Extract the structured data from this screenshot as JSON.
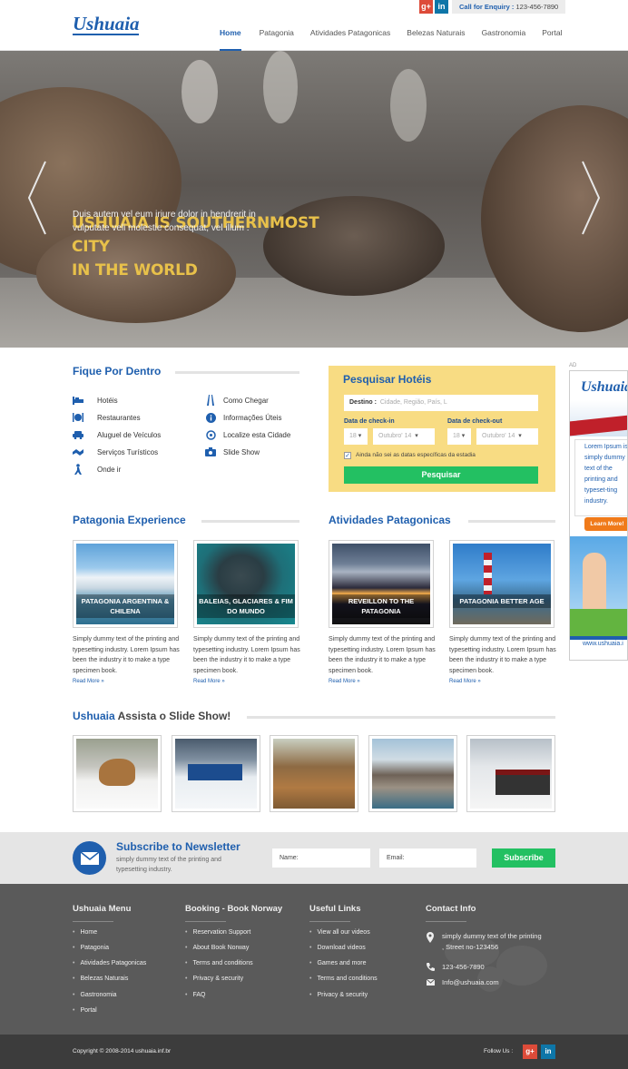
{
  "header": {
    "logo": "Ushuaia",
    "call_label": "Call for Enquiry :",
    "call_number": "123-456-7890",
    "social": [
      "g+",
      "in"
    ],
    "nav": [
      "Home",
      "Patagonia",
      "Atividades Patagonicas",
      "Belezas Naturais",
      "Gastronomia",
      "Portal"
    ]
  },
  "hero": {
    "title_line1": "USHUAIA IS  SOUTHERNMOST CITY",
    "title_line2": "IN THE WORLD",
    "subtitle": "Duis autem vel eum iriure dolor in hendrerit in vulputate veli molestie consequat, vel illum ."
  },
  "fique": {
    "title": "Fique Por Dentro",
    "items_left": [
      "Hotéis",
      "Restaurantes",
      "Aluguel de Veículos",
      "Serviços Turísticos",
      "Onde ir"
    ],
    "items_right": [
      "Como Chegar",
      "Informações Úteis",
      "Localize esta Cidade",
      "Slide Show"
    ]
  },
  "search": {
    "title": "Pesquisar Hotéis",
    "destino_label": "Destino :",
    "destino_placeholder": "Cidade, Região, País, L",
    "checkin_label": "Data de check-in",
    "checkout_label": "Data de check-out",
    "day_in": "18",
    "month_in": "Outubro' 14",
    "day_out": "18",
    "month_out": "Outubro' 14",
    "checkbox_label": "Ainda não sei as datas específicas da estadia",
    "button": "Pesquisar"
  },
  "ad": {
    "tag": "AD",
    "brand": "Ushuaia",
    "text": "Lorem Ipsum is simply dummy text of the printing and typeset-ting industry.",
    "button": "Learn More!",
    "url": "www.ushuaia.i"
  },
  "patagonia": {
    "title": "Patagonia Experience",
    "cards": [
      {
        "caption": "PATAGONIA ARGENTINA & CHILENA"
      },
      {
        "caption": "BALEIAS, GLACIARES & FIM DO MUNDO"
      }
    ]
  },
  "atividades": {
    "title": "Atividades Patagonicas",
    "cards": [
      {
        "caption": "REVEILLON TO THE PATAGONIA"
      },
      {
        "caption": "PATAGONIA BETTER AGE"
      }
    ]
  },
  "card_text": "Simply dummy text of the printing and typesetting industry. Lorem Ipsum has been the industry it to make a type specimen book.",
  "read_more": "Read More »",
  "slideshow": {
    "title_bold": "Ushuaia",
    "title_rest": "Assista o Slide Show!"
  },
  "newsletter": {
    "title": "Subscribe to Newsletter",
    "text": "simply dummy text of the printing and typesetting industry.",
    "name_placeholder": "Name:",
    "email_placeholder": "Email:",
    "button": "Subscribe"
  },
  "footer": {
    "cols": [
      {
        "title": "Ushuaia Menu",
        "items": [
          "Home",
          "Patagonia",
          "Atividades Patagonicas",
          "Belezas Naturais",
          "Gastronomia",
          "Portal"
        ]
      },
      {
        "title": "Booking - Book Norway",
        "items": [
          "Reservation Support",
          "About Book Norway",
          "Terms and conditions",
          "Privacy & security",
          "FAQ"
        ]
      },
      {
        "title": "Useful Links",
        "items": [
          "View all our videos",
          "Download videos",
          "Games and more",
          "Terms and conditions",
          "Privacy & security"
        ]
      }
    ],
    "contact": {
      "title": "Contact Info",
      "address": "simply dummy text of the printing , Street no-123456",
      "phone": "123-456-7890",
      "email": "Info@ushuaia.com"
    },
    "copyright": "Copyright © 2008-2014 ushuaia.inf.br",
    "follow": "Follow Us :"
  }
}
